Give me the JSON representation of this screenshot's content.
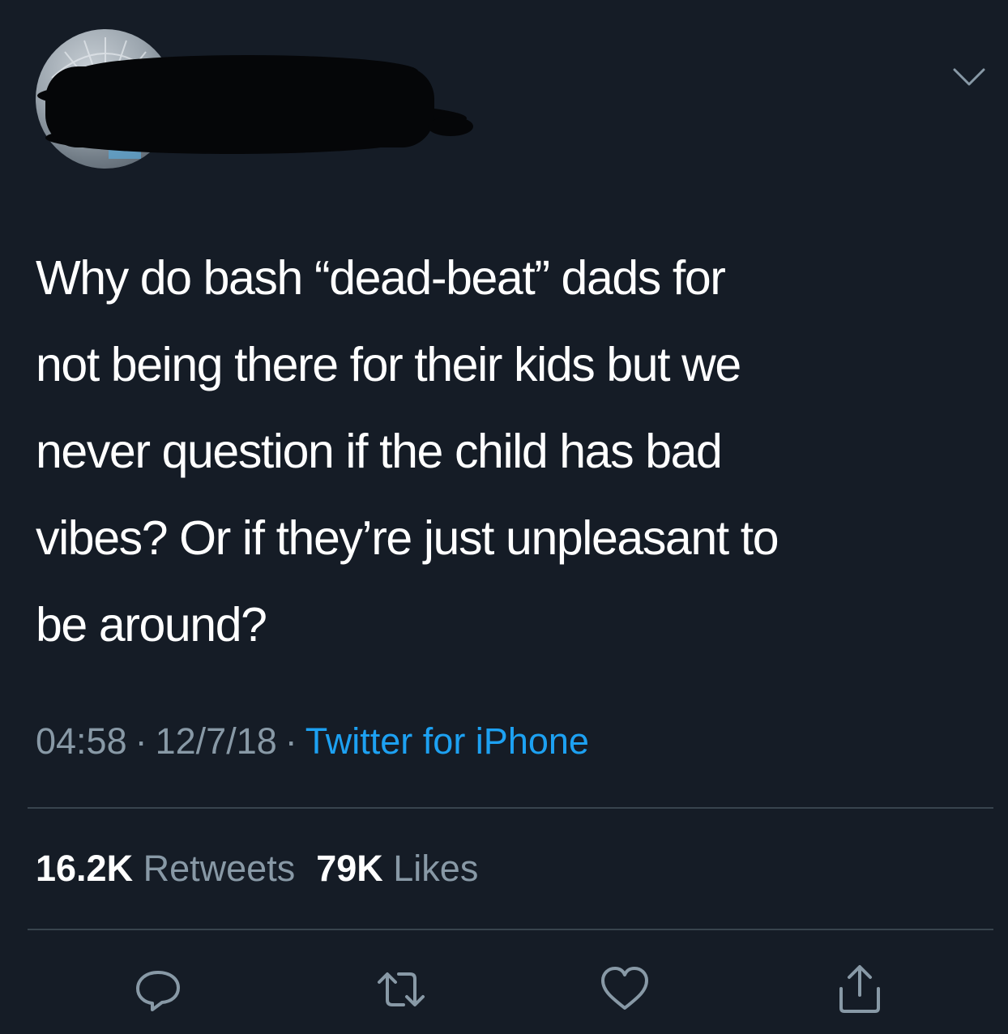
{
  "tweet": {
    "text": "Why do bash “dead-beat” dads for not being there for their kids but we never question if the child has bad vibes? Or if they’re just unpleasant to be around?",
    "text_lines": [
      "Why do bash “dead-beat” dads for",
      "not being there for their kids but we",
      "never question if the child has bad",
      "vibes? Or if they’re just unpleasant to",
      "be around?"
    ],
    "time": "04:58",
    "date": "12/7/18",
    "separator": "·",
    "source": "Twitter for iPhone"
  },
  "stats": {
    "retweets_count": "16.2K",
    "retweets_label": "Retweets",
    "likes_count": "79K",
    "likes_label": "Likes"
  },
  "icons": {
    "more": "chevron-down-icon",
    "reply": "reply-icon",
    "retweet": "retweet-icon",
    "like": "heart-icon",
    "share": "share-icon"
  },
  "colors": {
    "background": "#151c26",
    "text": "#ffffff",
    "muted": "#8899a6",
    "link": "#1da1f2",
    "divider": "#38444d"
  }
}
